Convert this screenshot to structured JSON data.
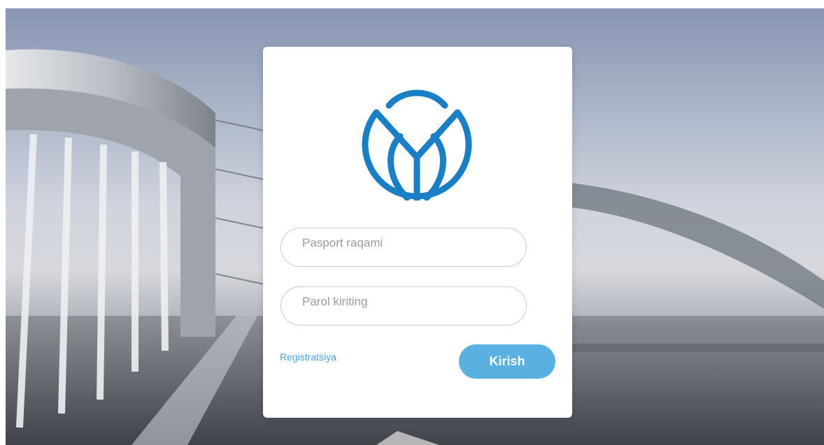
{
  "colors": {
    "accent": "#58b1e0",
    "link": "#4aa3d6",
    "logo": "#1a7fc5"
  },
  "background": {
    "subject": "bridge-highway-photo"
  },
  "logo": {
    "icon": "leaf-emblem-logo"
  },
  "form": {
    "passport_placeholder": "Pasport raqami",
    "password_placeholder": "Parol kiriting",
    "register_label": "Registratsiya",
    "login_label": "Kirish"
  }
}
